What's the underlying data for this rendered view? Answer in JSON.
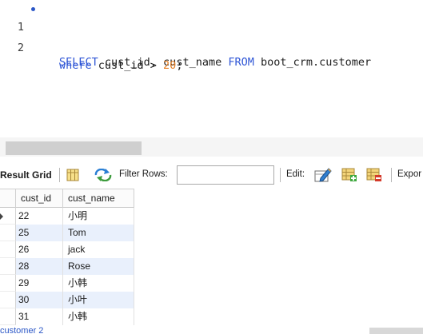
{
  "editor": {
    "lines": [
      {
        "number": "1",
        "tokens": [
          {
            "text": "SELECT",
            "kind": "keyword"
          },
          {
            "text": " cust_id, cust_name ",
            "kind": "plain"
          },
          {
            "text": "FROM",
            "kind": "keyword"
          },
          {
            "text": " boot_crm.customer",
            "kind": "plain"
          }
        ]
      },
      {
        "number": "2",
        "tokens": [
          {
            "text": "where",
            "kind": "keyword"
          },
          {
            "text": " cust_id > ",
            "kind": "plain"
          },
          {
            "text": "20",
            "kind": "number"
          },
          {
            "text": ";",
            "kind": "plain"
          }
        ]
      }
    ]
  },
  "toolbar": {
    "result_grid_label": "Result Grid",
    "filter_label": "Filter Rows:",
    "filter_value": "",
    "edit_label": "Edit:",
    "export_label": "Expor"
  },
  "grid": {
    "columns": [
      "cust_id",
      "cust_name"
    ],
    "rows": [
      {
        "cust_id": "22",
        "cust_name": "小明"
      },
      {
        "cust_id": "25",
        "cust_name": "Tom"
      },
      {
        "cust_id": "26",
        "cust_name": "jack"
      },
      {
        "cust_id": "28",
        "cust_name": "Rose"
      },
      {
        "cust_id": "29",
        "cust_name": "小韩"
      },
      {
        "cust_id": "30",
        "cust_name": "小叶"
      },
      {
        "cust_id": "31",
        "cust_name": "小韩"
      }
    ]
  },
  "status": {
    "tab_label": "customer 2"
  },
  "colors": {
    "keyword": "#2f56d6",
    "number": "#e67e22",
    "alt_row": "#e9f0fc"
  }
}
